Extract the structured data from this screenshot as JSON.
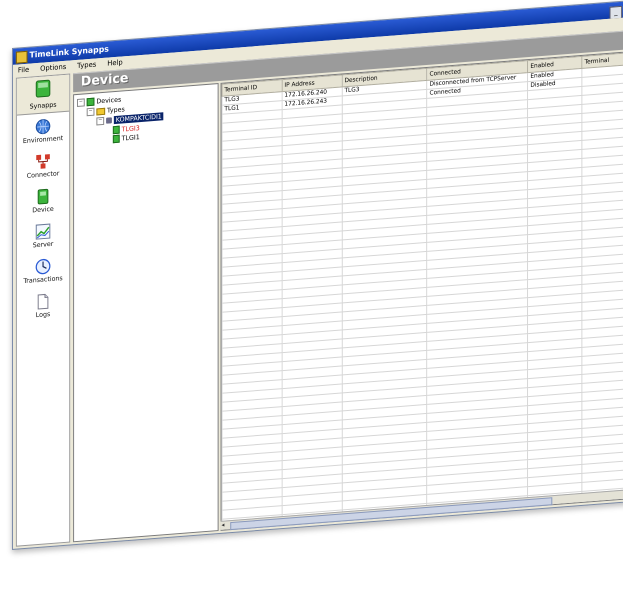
{
  "window": {
    "title": "TimeLink Synapps"
  },
  "menu": [
    "File",
    "Options",
    "Types",
    "Help"
  ],
  "sidebar": {
    "top_label": "Synapps",
    "items": [
      {
        "label": "Environment",
        "icon": "globe-icon"
      },
      {
        "label": "Connector",
        "icon": "connector-icon"
      },
      {
        "label": "Device",
        "icon": "device-icon"
      },
      {
        "label": "Server",
        "icon": "chart-icon"
      },
      {
        "label": "Transactions",
        "icon": "clock-icon"
      },
      {
        "label": "Logs",
        "icon": "document-icon"
      }
    ]
  },
  "header": {
    "title": "Device"
  },
  "tree": {
    "root": "Devices",
    "types": "Types",
    "selected": "KOMPAKTCIDI1",
    "children": [
      "TLGI3",
      "TLGI1"
    ]
  },
  "grid": {
    "columns": [
      "Terminal ID",
      "IP Address",
      "Description",
      "Connected",
      "Enabled",
      "Terminal"
    ],
    "rows": [
      [
        "TLG3",
        "172.16.26.240",
        "TLG3",
        "Disconnected from TCPServer",
        "Enabled",
        ""
      ],
      [
        "TLG1",
        "172.16.26.243",
        "",
        "Connected",
        "Disabled",
        ""
      ]
    ]
  },
  "colors": {
    "titlebar": "#0e3aa8",
    "header": "#9b9b9b",
    "selection": "#0a246a",
    "device_green": "#3cb43c"
  }
}
